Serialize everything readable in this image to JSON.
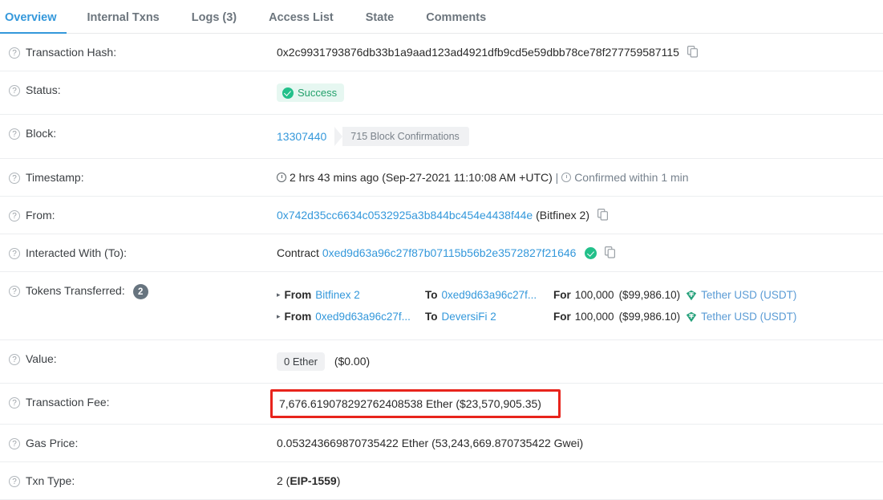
{
  "tabs": [
    {
      "label": "Overview",
      "active": true
    },
    {
      "label": "Internal Txns",
      "active": false
    },
    {
      "label": "Logs (3)",
      "active": false
    },
    {
      "label": "Access List",
      "active": false
    },
    {
      "label": "State",
      "active": false
    },
    {
      "label": "Comments",
      "active": false
    }
  ],
  "rows": {
    "transaction_hash": {
      "label": "Transaction Hash:",
      "value": "0x2c9931793876db33b1a9aad123ad4921dfb9cd5e59dbb78ce78f277759587115",
      "copy_icon": "copy-icon"
    },
    "status": {
      "label": "Status:",
      "badge_text": "Success",
      "badge_icon": "check-circle-icon",
      "badge_bg": "#e6f7f1",
      "badge_color": "#22a06b"
    },
    "block": {
      "label": "Block:",
      "number": "13307440",
      "confirmations": "715 Block Confirmations"
    },
    "timestamp": {
      "label": "Timestamp:",
      "clock_icon": "clock-icon",
      "relative": "2 hrs 43 mins ago",
      "absolute": "(Sep-27-2021 11:10:08 AM +UTC)",
      "separator": "|",
      "confirmed_icon": "clock-icon",
      "confirmed": "Confirmed within 1 min"
    },
    "from": {
      "label": "From:",
      "address": "0x742d35cc6634c0532925a3b844bc454e4438f44e",
      "tag": "(Bitfinex 2)",
      "copy_icon": "copy-icon"
    },
    "interacted_with": {
      "label": "Interacted With (To):",
      "prefix": "Contract",
      "address": "0xed9d63a96c27f87b07115b56b2e3572827f21646",
      "verified_icon": "verified-check-icon",
      "copy_icon": "copy-icon"
    },
    "tokens_transferred": {
      "label": "Tokens Transferred:",
      "count": "2",
      "kw_from": "From",
      "kw_to": "To",
      "kw_for": "For",
      "transfers": [
        {
          "from": "Bitfinex 2",
          "to": "0xed9d63a96c27f...",
          "amount": "100,000",
          "usd": "($99,986.10)",
          "token": "Tether USD (USDT)",
          "token_icon": "tether-icon"
        },
        {
          "from": "0xed9d63a96c27f...",
          "to": "DeversiFi 2",
          "amount": "100,000",
          "usd": "($99,986.10)",
          "token": "Tether USD (USDT)",
          "token_icon": "tether-icon"
        }
      ]
    },
    "value": {
      "label": "Value:",
      "ether": "0 Ether",
      "usd": "($0.00)"
    },
    "transaction_fee": {
      "label": "Transaction Fee:",
      "value": "7,676.619078292762408538 Ether ($23,570,905.35)",
      "highlight_color": "#e8241c"
    },
    "gas_price": {
      "label": "Gas Price:",
      "value": "0.053243669870735422 Ether (53,243,669.870735422 Gwei)"
    },
    "txn_type": {
      "label": "Txn Type:",
      "number": "2 (",
      "eip": "EIP-1559",
      "suffix": ")"
    }
  },
  "colors": {
    "link": "#3498db",
    "active_tab": "#3498db",
    "success": "#22a06b",
    "highlight": "#e8241c"
  }
}
